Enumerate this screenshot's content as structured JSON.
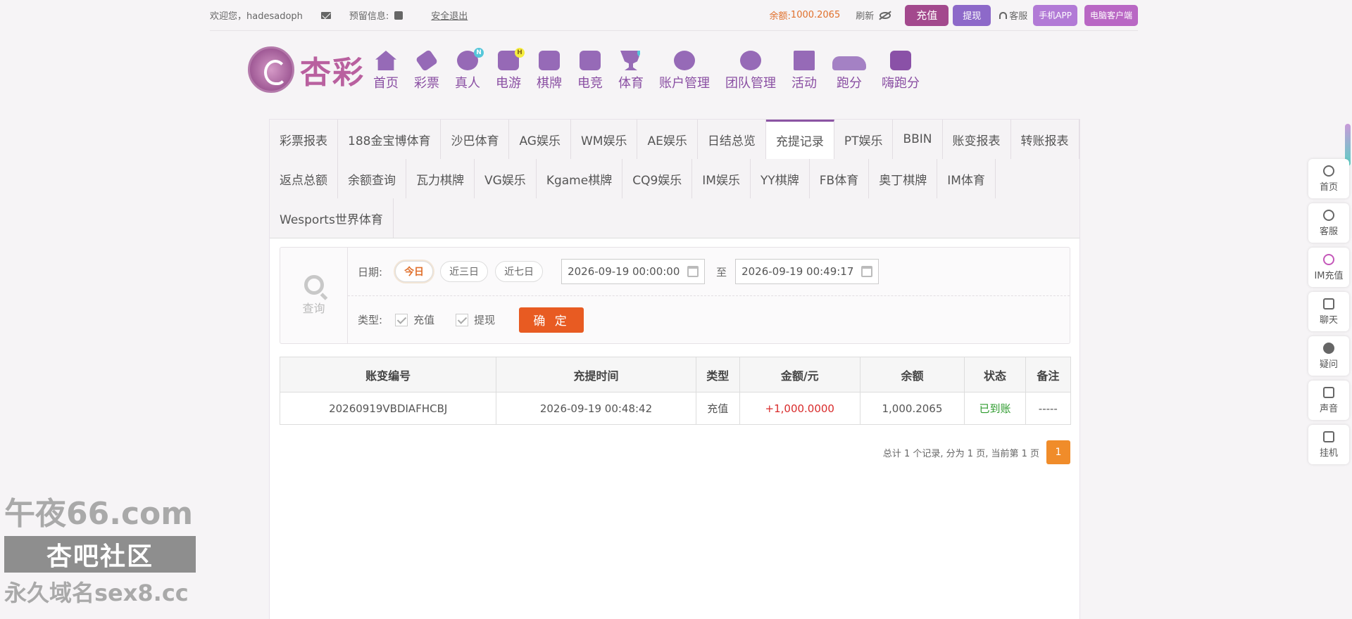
{
  "topbar": {
    "welcome": "欢迎您，hadesadoph",
    "reserve_label": "预留信息:",
    "logout": "安全退出",
    "balance_label": "余额:",
    "balance_value": "1000.2065",
    "refresh": "刷新",
    "recharge": "充值",
    "withdraw": "提现",
    "service": "客服",
    "app": "手机APP",
    "pc_client": "电脑客户端"
  },
  "logo": {
    "text": "杏彩"
  },
  "nav": [
    {
      "label": "首页",
      "icon": "home-icon"
    },
    {
      "label": "彩票",
      "icon": "lottery-ticket-icon"
    },
    {
      "label": "真人",
      "icon": "live-dealer-icon",
      "badge": "N"
    },
    {
      "label": "电游",
      "icon": "gamepad-icon",
      "badge": "H"
    },
    {
      "label": "棋牌",
      "icon": "cards-icon"
    },
    {
      "label": "电竞",
      "icon": "esports-controller-icon"
    },
    {
      "label": "体育",
      "icon": "trophy-icon",
      "badge": "N"
    },
    {
      "label": "账户管理",
      "icon": "account-icon"
    },
    {
      "label": "团队管理",
      "icon": "team-icon"
    },
    {
      "label": "活动",
      "icon": "gift-icon"
    },
    {
      "label": "跑分",
      "icon": "car-icon"
    },
    {
      "label": "嗨跑分",
      "icon": "hi-icon"
    }
  ],
  "tabs": [
    "彩票报表",
    "188金宝博体育",
    "沙巴体育",
    "AG娱乐",
    "WM娱乐",
    "AE娱乐",
    "日结总览",
    "充提记录",
    "PT娱乐",
    "BBIN",
    "账变报表",
    "转账报表",
    "返点总额",
    "余额查询",
    "瓦力棋牌",
    "VG娱乐",
    "Kgame棋牌",
    "CQ9娱乐",
    "IM娱乐",
    "YY棋牌",
    "FB体育",
    "奥丁棋牌",
    "IM体育",
    "Wesports世界体育"
  ],
  "active_tab": "充提记录",
  "query": {
    "title": "查询",
    "date_label": "日期:",
    "ranges": [
      "今日",
      "近三日",
      "近七日"
    ],
    "active_range": "今日",
    "start": "2026-09-19 00:00:00",
    "to": "至",
    "end": "2026-09-19 00:49:17",
    "type_label": "类型:",
    "types": [
      "充值",
      "提现"
    ],
    "confirm": "确 定"
  },
  "table": {
    "headers": [
      "账变编号",
      "充提时间",
      "类型",
      "金额/元",
      "余额",
      "状态",
      "备注"
    ],
    "rows": [
      [
        "20260919VBDIAFHCBJ",
        "2026-09-19 00:48:42",
        "充值",
        "+1,000.0000",
        "1,000.2065",
        "已到账",
        "-----"
      ]
    ]
  },
  "pager": {
    "summary": "总计 1 个记录, 分为 1 页, 当前第 1 页",
    "current": "1"
  },
  "float": [
    {
      "label": "首页",
      "icon": "arrow-up-icon"
    },
    {
      "label": "客服",
      "icon": "headset-icon"
    },
    {
      "label": "IM充值",
      "icon": "im-recharge-icon"
    },
    {
      "label": "聊天",
      "icon": "chat-icon"
    },
    {
      "label": "疑问",
      "icon": "question-icon"
    },
    {
      "label": "声音",
      "icon": "speaker-icon"
    },
    {
      "label": "挂机",
      "icon": "diamond-icon"
    }
  ],
  "watermark": {
    "line1": "午夜66.com",
    "line2": "杏吧社区",
    "line3": "永久域名sex8.cc"
  },
  "colors": {
    "brand": "#a3498d",
    "accent": "#e85b22",
    "amount": "#d92b2b",
    "success": "#2e9b2e"
  }
}
